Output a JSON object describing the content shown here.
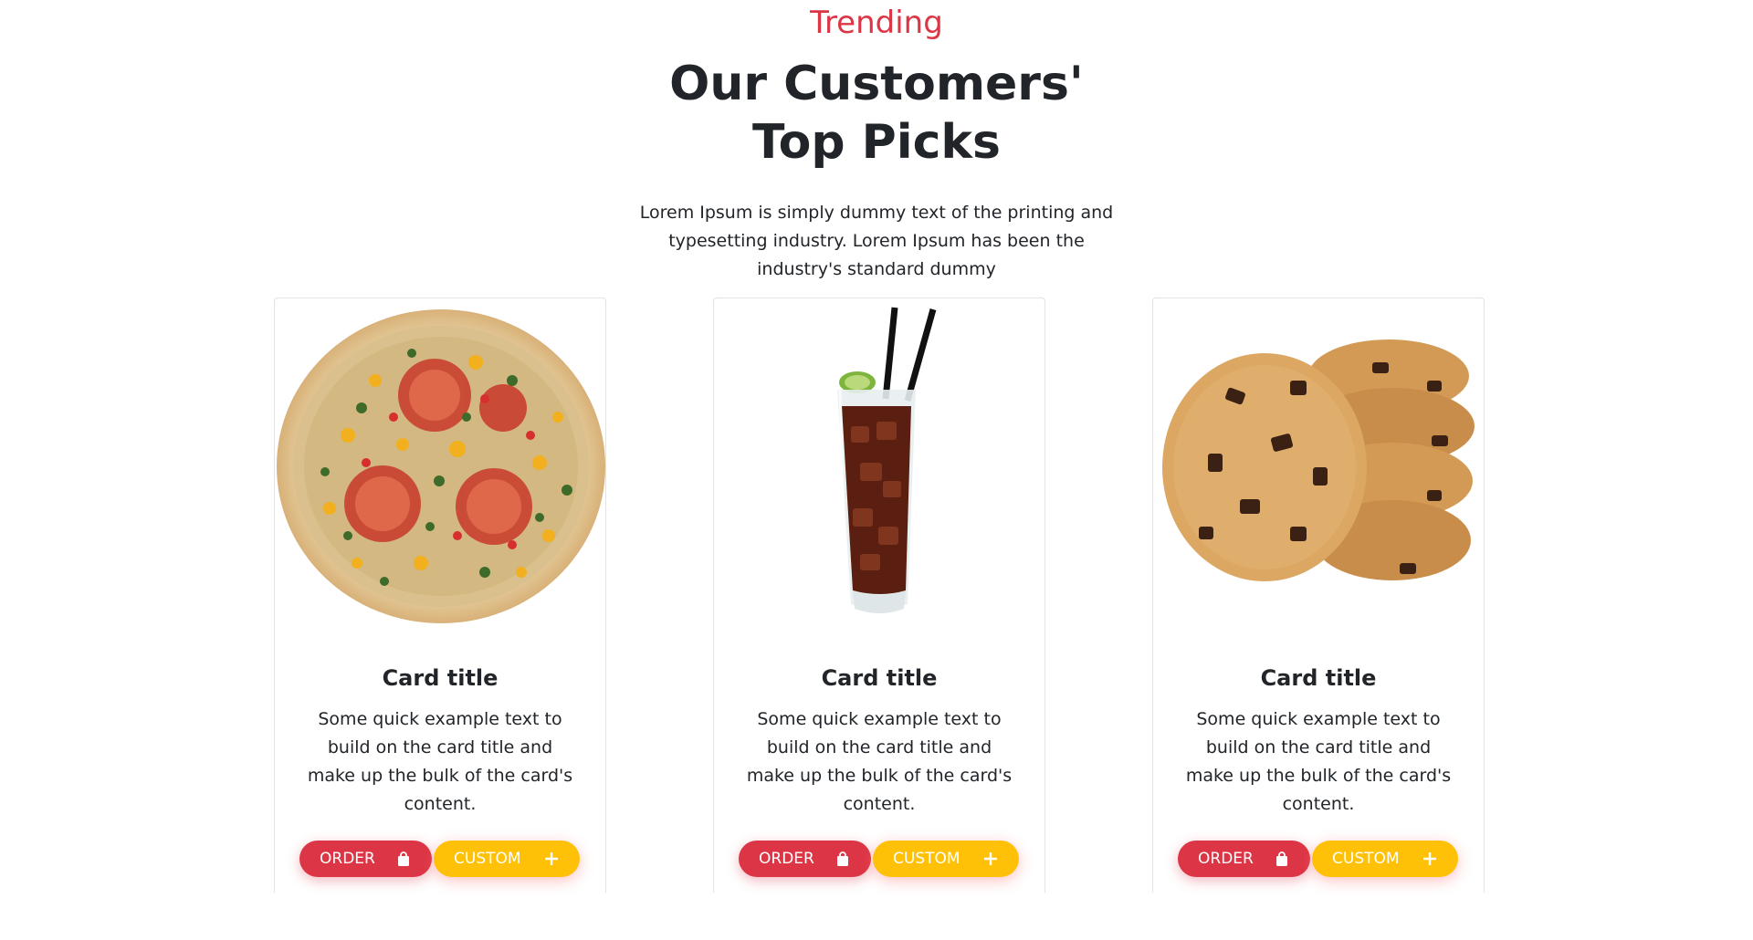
{
  "header": {
    "eyebrow": "Trending",
    "title": "Our Customers' Top Picks",
    "lead": "Lorem Ipsum is simply dummy text of the printing and typesetting industry. Lorem Ipsum has been the industry's standard dummy"
  },
  "cards": [
    {
      "image": "pizza-image",
      "title": "Card title",
      "text": "Some quick example text to build on the card title and make up the bulk of the card's content.",
      "order_label": "ORDER",
      "order_icon": "shopping-bag-icon",
      "custom_label": "CUSTOM",
      "custom_icon": "plus-icon"
    },
    {
      "image": "cola-drink-image",
      "title": "Card title",
      "text": "Some quick example text to build on the card title and make up the bulk of the card's content.",
      "order_label": "ORDER",
      "order_icon": "shopping-bag-icon",
      "custom_label": "CUSTOM",
      "custom_icon": "plus-icon"
    },
    {
      "image": "cookies-image",
      "title": "Card title",
      "text": "Some quick example text to build on the card title and make up the bulk of the card's content.",
      "order_label": "ORDER",
      "order_icon": "shopping-bag-icon",
      "custom_label": "CUSTOM",
      "custom_icon": "plus-icon"
    }
  ],
  "colors": {
    "accent_red": "#dc3545",
    "accent_yellow": "#ffc107",
    "text": "#212529"
  }
}
